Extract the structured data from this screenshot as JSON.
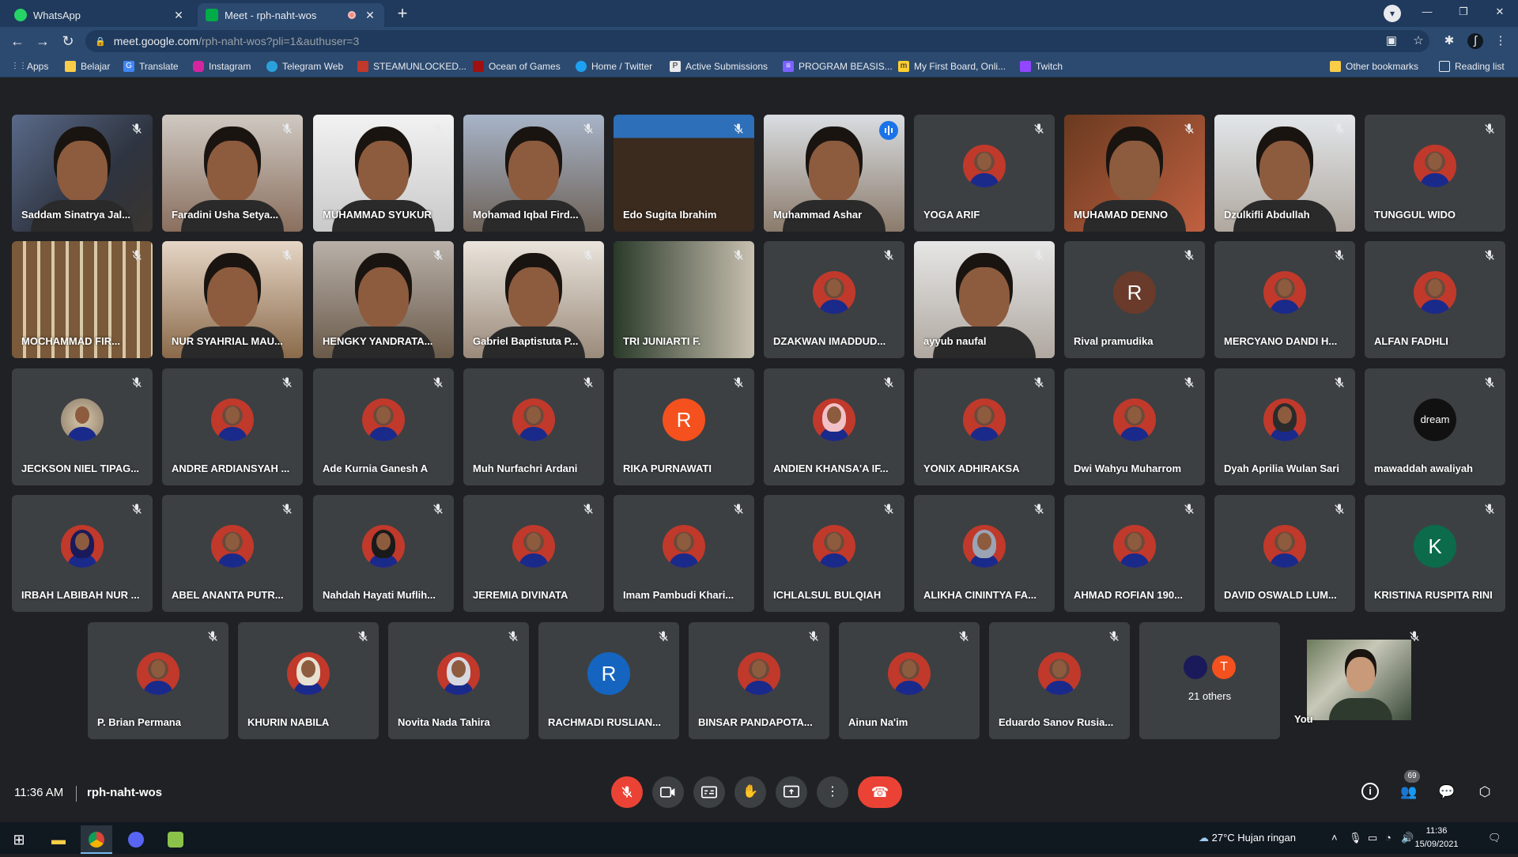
{
  "browser": {
    "tabs": [
      {
        "title": "WhatsApp",
        "active": false
      },
      {
        "title": "Meet - rph-naht-wos",
        "active": true
      }
    ],
    "url_host": "meet.google.com",
    "url_path": "/rph-naht-wos?pli=1&authuser=3",
    "bookmarks": [
      "Apps",
      "Belajar",
      "Translate",
      "Instagram",
      "Telegram Web",
      "STEAMUNLOCKED...",
      "Ocean of Games",
      "Home / Twitter",
      "Active Submissions",
      "PROGRAM BEASIS...",
      "My First Board, Onli...",
      "Twitch"
    ],
    "other_bookmarks": "Other bookmarks",
    "reading_list": "Reading list"
  },
  "participants": [
    {
      "name": "Saddam Sinatrya Jal..."
    },
    {
      "name": "Faradini Usha Setya..."
    },
    {
      "name": "MUHAMMAD SYUKUR"
    },
    {
      "name": "Mohamad Iqbal Fird..."
    },
    {
      "name": "Edo Sugita Ibrahim"
    },
    {
      "name": "Muhammad Ashar"
    },
    {
      "name": "YOGA ARIF"
    },
    {
      "name": "MUHAMAD DENNO"
    },
    {
      "name": "Dzulkifli Abdullah"
    },
    {
      "name": "TUNGGUL WIDO"
    },
    {
      "name": "MOCHAMMAD FIR..."
    },
    {
      "name": "NUR SYAHRIAL MAU..."
    },
    {
      "name": "HENGKY YANDRATA..."
    },
    {
      "name": "Gabriel Baptistuta P..."
    },
    {
      "name": "TRI JUNIARTI F."
    },
    {
      "name": "DZAKWAN IMADDUD..."
    },
    {
      "name": "ayyub naufal"
    },
    {
      "name": "Rival pramudika",
      "letter": "R"
    },
    {
      "name": "MERCYANO DANDI H..."
    },
    {
      "name": "ALFAN FADHLI"
    },
    {
      "name": "JECKSON NIEL TIPAG..."
    },
    {
      "name": "ANDRE ARDIANSYAH ..."
    },
    {
      "name": "Ade Kurnia Ganesh A"
    },
    {
      "name": "Muh Nurfachri Ardani"
    },
    {
      "name": "RIKA PURNAWATI",
      "letter": "R"
    },
    {
      "name": "ANDIEN KHANSA'A IF..."
    },
    {
      "name": "YONIX ADHIRAKSA"
    },
    {
      "name": "Dwi Wahyu Muharrom"
    },
    {
      "name": "Dyah Aprilia Wulan Sari"
    },
    {
      "name": "mawaddah awaliyah",
      "letter": "dream"
    },
    {
      "name": "IRBAH LABIBAH NUR ..."
    },
    {
      "name": "ABEL ANANTA PUTR..."
    },
    {
      "name": "Nahdah Hayati Muflih..."
    },
    {
      "name": "JEREMIA DIVINATA"
    },
    {
      "name": "Imam Pambudi Khari..."
    },
    {
      "name": "ICHLALSUL BULQIAH"
    },
    {
      "name": "ALIKHA CININTYA FA..."
    },
    {
      "name": "AHMAD ROFIAN 190..."
    },
    {
      "name": "DAVID OSWALD LUM..."
    },
    {
      "name": "KRISTINA RUSPITA RINI",
      "letter": "K"
    },
    {
      "name": "P. Brian Permana"
    },
    {
      "name": "KHURIN NABILA"
    },
    {
      "name": "Novita Nada Tahira"
    },
    {
      "name": "RACHMADI RUSLIAN...",
      "letter": "R"
    },
    {
      "name": "BINSAR PANDAPOTA..."
    },
    {
      "name": "Ainun Na'im"
    },
    {
      "name": "Eduardo Sanov Rusia..."
    }
  ],
  "others": {
    "label": "21 others",
    "letter": "T"
  },
  "self": {
    "name": "You"
  },
  "meeting": {
    "time": "11:36 AM",
    "code": "rph-naht-wos",
    "participant_count": "69"
  },
  "taskbar": {
    "weather": "27°C  Hujan ringan",
    "time": "11:36",
    "date": "15/09/2021"
  }
}
